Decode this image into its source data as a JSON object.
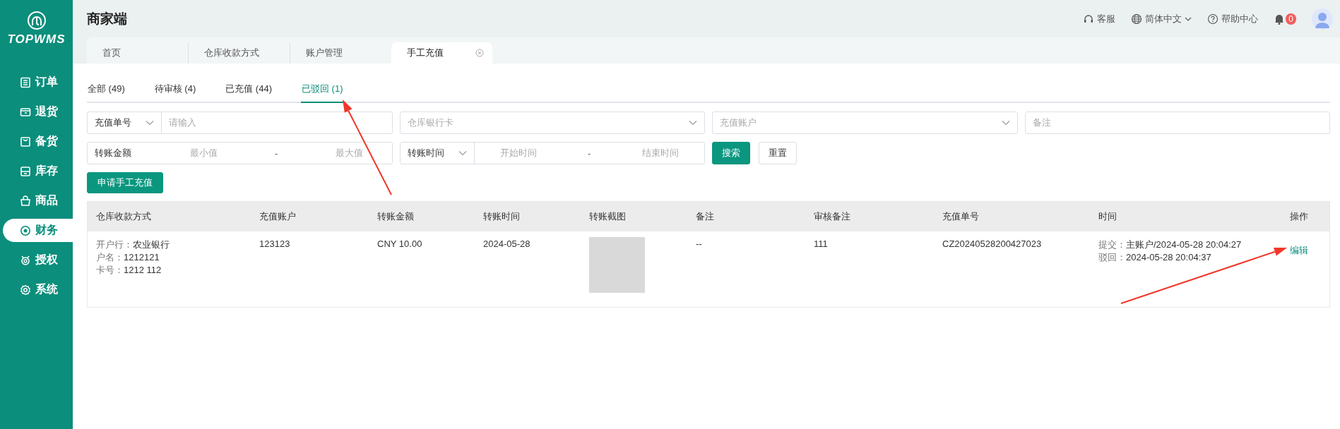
{
  "sidebar": {
    "logo_text": "TOPWMS",
    "items": [
      {
        "label": "订单",
        "selected": false
      },
      {
        "label": "退货",
        "selected": false
      },
      {
        "label": "备货",
        "selected": false
      },
      {
        "label": "库存",
        "selected": false
      },
      {
        "label": "商品",
        "selected": false
      },
      {
        "label": "财务",
        "selected": true
      },
      {
        "label": "授权",
        "selected": false
      },
      {
        "label": "系统",
        "selected": false
      }
    ]
  },
  "header": {
    "title": "商家端",
    "actions": [
      {
        "kind": "service",
        "label": "客服"
      },
      {
        "kind": "language",
        "label": "简体中文"
      },
      {
        "kind": "help",
        "label": "帮助中心"
      }
    ],
    "notification_count": "0"
  },
  "page_tabs": [
    {
      "label": "首页",
      "selected": false,
      "closable": false
    },
    {
      "label": "仓库收款方式",
      "selected": false,
      "closable": false
    },
    {
      "label": "账户管理",
      "selected": false,
      "closable": false
    },
    {
      "label": "手工充值",
      "selected": true,
      "closable": true
    }
  ],
  "status_tabs": [
    {
      "label": "全部 (49)",
      "selected": false
    },
    {
      "label": "待审核 (4)",
      "selected": false
    },
    {
      "label": "已充值 (44)",
      "selected": false
    },
    {
      "label": "已驳回 (1)",
      "selected": true
    }
  ],
  "filters": [
    {
      "kind": "select_input",
      "select": "充值单号",
      "placeholder": "请输入"
    },
    {
      "kind": "select",
      "placeholder": "仓库银行卡"
    },
    {
      "kind": "select",
      "placeholder": "充值账户"
    },
    {
      "kind": "input",
      "placeholder": "备注"
    },
    {
      "kind": "range",
      "label": "转账金额",
      "from_placeholder": "最小值",
      "separator": "-",
      "to_placeholder": "最大值"
    },
    {
      "kind": "select_range",
      "select": "转账时间",
      "from_placeholder": "开始时间",
      "separator": "-",
      "to_placeholder": "结束时间"
    }
  ],
  "filter_buttons": [
    {
      "label": "搜索",
      "primary": true
    },
    {
      "label": "重置",
      "primary": false
    }
  ],
  "create_button": "申请手工充值",
  "table": {
    "columns": [
      "仓库收款方式",
      "充值账户",
      "转账金额",
      "转账时间",
      "转账截图",
      "备注",
      "审核备注",
      "充值单号",
      "时间",
      "操作"
    ],
    "rows": [
      {
        "payment_method": [
          {
            "label": "开户行：",
            "value": "农业银行"
          },
          {
            "label": "户名：",
            "value": "1212121"
          },
          {
            "label": "卡号：",
            "value": "1212 112"
          }
        ],
        "account": "123123",
        "amount": "CNY 10.00",
        "transfer_time": "2024-05-28",
        "remark": "--",
        "review_remark": "111",
        "order_no": "CZ20240528200427023",
        "times": [
          {
            "label": "提交：",
            "value": "主账户/2024-05-28 20:04:27"
          },
          {
            "label": "驳回：",
            "value": "2024-05-28 20:04:37"
          }
        ],
        "action": "编辑"
      }
    ]
  },
  "annotations": [
    {
      "kind": "arrow"
    },
    {
      "kind": "arrow"
    }
  ]
}
